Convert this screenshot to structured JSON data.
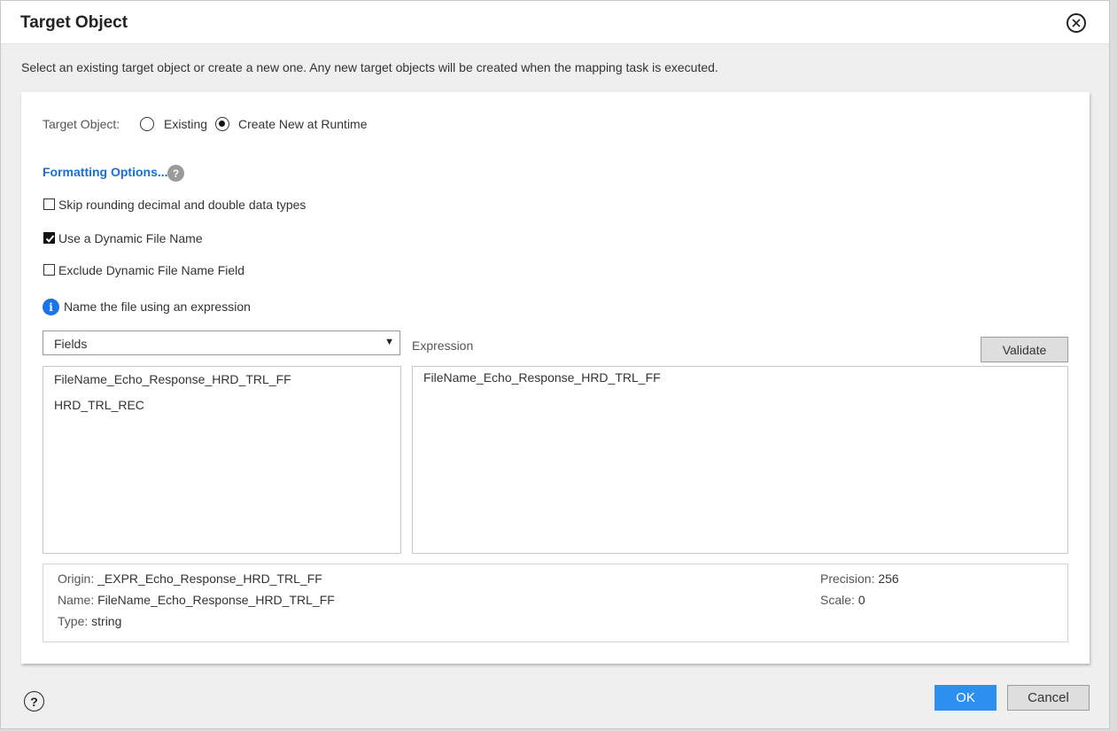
{
  "dialog": {
    "title": "Target Object",
    "subtitle": "Select an existing target object or create a new one. Any new target objects will be created when the mapping task is executed."
  },
  "target_object": {
    "label": "Target Object:",
    "options": [
      {
        "label": "Existing",
        "selected": false
      },
      {
        "label": "Create New at Runtime",
        "selected": true
      }
    ]
  },
  "formatting": {
    "link_label": "Formatting Options...",
    "help_glyph": "?"
  },
  "checkboxes": [
    {
      "label": "Skip rounding decimal and double data types",
      "checked": false
    },
    {
      "label": "Use a Dynamic File Name",
      "checked": true
    },
    {
      "label": "Exclude Dynamic File Name Field",
      "checked": false
    }
  ],
  "info_note": {
    "glyph": "i",
    "text": "Name the file using an expression"
  },
  "fields_select": {
    "value": "Fields",
    "caret": "▼"
  },
  "fields_list": [
    "FileName_Echo_Response_HRD_TRL_FF",
    "HRD_TRL_REC"
  ],
  "expression": {
    "label": "Expression",
    "validate_label": "Validate",
    "value": "FileName_Echo_Response_HRD_TRL_FF"
  },
  "field_info": {
    "origin_key": "Origin:",
    "origin_value": "_EXPR_Echo_Response_HRD_TRL_FF",
    "name_key": "Name:",
    "name_value": "FileName_Echo_Response_HRD_TRL_FF",
    "type_key": "Type:",
    "type_value": "string",
    "precision_key": "Precision:",
    "precision_value": "256",
    "scale_key": "Scale:",
    "scale_value": "0"
  },
  "footer": {
    "help_glyph": "?",
    "ok_label": "OK",
    "cancel_label": "Cancel"
  },
  "colors": {
    "link": "#1a6fd1",
    "primary_button": "#2d8ff0",
    "info_icon": "#1a73e8"
  }
}
